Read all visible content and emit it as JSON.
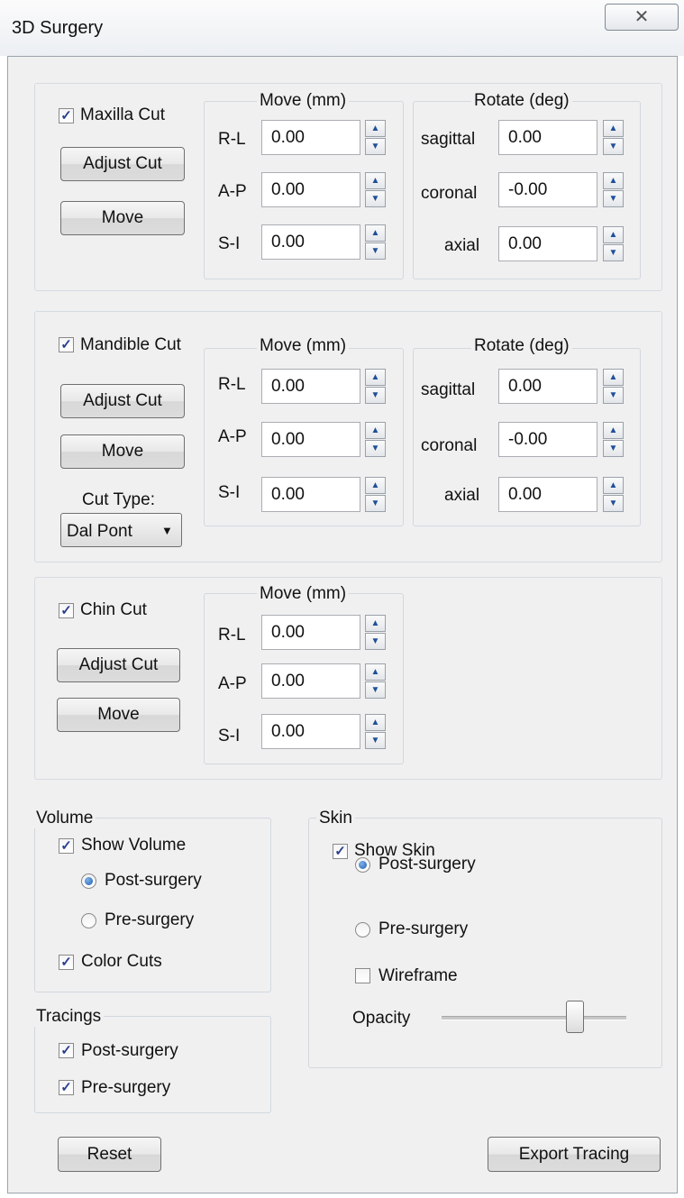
{
  "window": {
    "title": "3D Surgery",
    "close_glyph": "✕"
  },
  "labels": {
    "move": "Move (mm)",
    "rotate": "Rotate (deg)",
    "rl": "R-L",
    "ap": "A-P",
    "si": "S-I",
    "sagittal": "sagittal",
    "coronal": "coronal",
    "axial": "axial",
    "adjust_cut": "Adjust Cut",
    "move_btn": "Move",
    "spin_up": "▲",
    "spin_down": "▼"
  },
  "maxilla": {
    "checkbox_label": "Maxilla Cut",
    "checked": true,
    "move": {
      "rl": "0.00",
      "ap": "0.00",
      "si": "0.00"
    },
    "rotate": {
      "sagittal": "0.00",
      "coronal": "-0.00",
      "axial": "0.00"
    }
  },
  "mandible": {
    "checkbox_label": "Mandible Cut",
    "checked": true,
    "move": {
      "rl": "0.00",
      "ap": "0.00",
      "si": "0.00"
    },
    "rotate": {
      "sagittal": "0.00",
      "coronal": "-0.00",
      "axial": "0.00"
    },
    "cut_type_label": "Cut Type:",
    "cut_type_value": "Dal Pont",
    "cut_type_arrow": "▼"
  },
  "chin": {
    "checkbox_label": "Chin Cut",
    "checked": true,
    "move": {
      "rl": "0.00",
      "ap": "0.00",
      "si": "0.00"
    }
  },
  "volume": {
    "group_label": "Volume",
    "show_label": "Show Volume",
    "show_checked": true,
    "post_label": "Post-surgery",
    "post_selected": true,
    "pre_label": "Pre-surgery",
    "pre_selected": false,
    "color_cuts_label": "Color Cuts",
    "color_cuts_checked": true
  },
  "tracings": {
    "group_label": "Tracings",
    "post_label": "Post-surgery",
    "post_checked": true,
    "pre_label": "Pre-surgery",
    "pre_checked": true
  },
  "skin": {
    "group_label": "Skin",
    "show_label": "Show Skin",
    "show_checked": true,
    "post_label": "Post-surgery",
    "post_selected": true,
    "pre_label": "Pre-surgery",
    "pre_selected": false,
    "wireframe_label": "Wireframe",
    "wireframe_checked": false,
    "opacity_label": "Opacity",
    "opacity_value": 0.72
  },
  "footer": {
    "reset_label": "Reset",
    "export_label": "Export Tracing"
  },
  "colors": {
    "check": "#2a3f8f",
    "radio": "#1d5fb0",
    "panel_bg": "#f0f0f0"
  }
}
